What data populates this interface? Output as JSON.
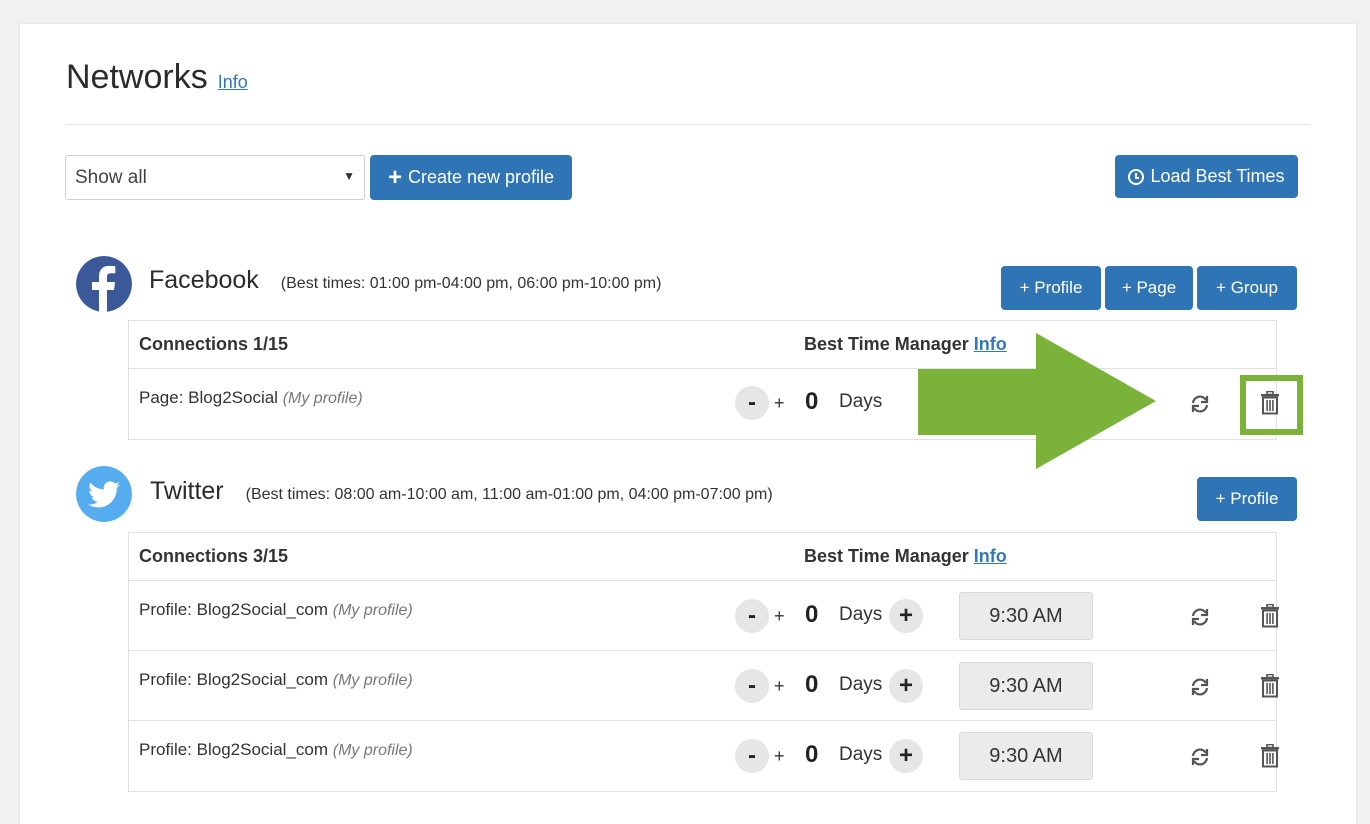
{
  "header": {
    "title": "Networks",
    "info_label": "Info"
  },
  "toolbar": {
    "filter_value": "Show all",
    "create_label": "Create new profile",
    "load_label": "Load Best Times"
  },
  "facebook": {
    "name": "Facebook",
    "best_times": "(Best times: 01:00 pm-04:00 pm, 06:00 pm-10:00 pm)",
    "buttons": [
      "+ Profile",
      "+ Page",
      "+ Group"
    ],
    "connections_label": "Connections 1/15",
    "best_time_manager": "Best Time Manager",
    "info_label": "Info",
    "rows": [
      {
        "type": "Page:",
        "name": "Blog2Social",
        "tag": "(My profile)",
        "days": "0",
        "days_label": "Days"
      }
    ]
  },
  "twitter": {
    "name": "Twitter",
    "best_times": "(Best times: 08:00 am-10:00 am, 11:00 am-01:00 pm, 04:00 pm-07:00 pm)",
    "buttons": [
      "+ Profile"
    ],
    "connections_label": "Connections 3/15",
    "best_time_manager": "Best Time Manager",
    "info_label": "Info",
    "rows": [
      {
        "type": "Profile:",
        "name": "Blog2Social_com",
        "tag": "(My profile)",
        "days": "0",
        "days_label": "Days",
        "time": "9:30 AM"
      },
      {
        "type": "Profile:",
        "name": "Blog2Social_com",
        "tag": "(My profile)",
        "days": "0",
        "days_label": "Days",
        "time": "9:30 AM"
      },
      {
        "type": "Profile:",
        "name": "Blog2Social_com",
        "tag": "(My profile)",
        "days": "0",
        "days_label": "Days",
        "time": "9:30 AM"
      }
    ]
  },
  "stepper": {
    "minus": "-",
    "plus_small": "+",
    "plus": "+"
  },
  "colors": {
    "primary": "#2f75b5",
    "facebook": "#3b5998",
    "twitter": "#55acee",
    "annotation": "#7ab23a"
  }
}
